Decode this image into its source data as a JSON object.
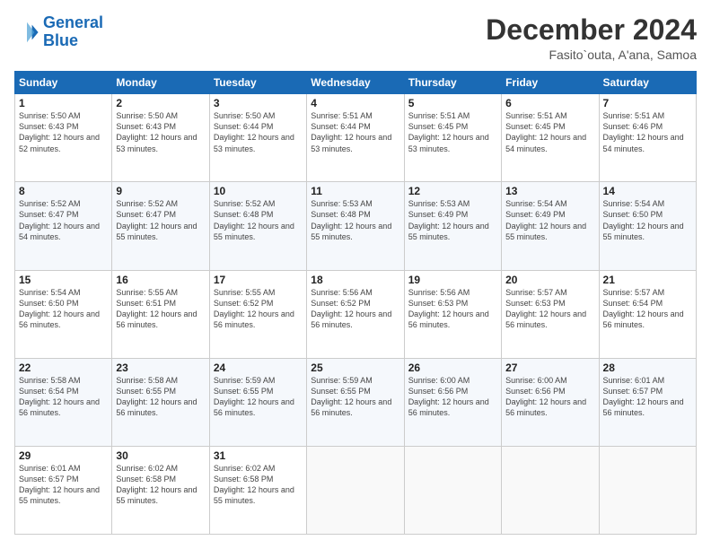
{
  "logo": {
    "line1": "General",
    "line2": "Blue"
  },
  "title": "December 2024",
  "location": "Fasito`outa, A'ana, Samoa",
  "days_header": [
    "Sunday",
    "Monday",
    "Tuesday",
    "Wednesday",
    "Thursday",
    "Friday",
    "Saturday"
  ],
  "weeks": [
    [
      {
        "num": "1",
        "sunrise": "5:50 AM",
        "sunset": "6:43 PM",
        "daylight": "12 hours and 52 minutes."
      },
      {
        "num": "2",
        "sunrise": "5:50 AM",
        "sunset": "6:43 PM",
        "daylight": "12 hours and 53 minutes."
      },
      {
        "num": "3",
        "sunrise": "5:50 AM",
        "sunset": "6:44 PM",
        "daylight": "12 hours and 53 minutes."
      },
      {
        "num": "4",
        "sunrise": "5:51 AM",
        "sunset": "6:44 PM",
        "daylight": "12 hours and 53 minutes."
      },
      {
        "num": "5",
        "sunrise": "5:51 AM",
        "sunset": "6:45 PM",
        "daylight": "12 hours and 53 minutes."
      },
      {
        "num": "6",
        "sunrise": "5:51 AM",
        "sunset": "6:45 PM",
        "daylight": "12 hours and 54 minutes."
      },
      {
        "num": "7",
        "sunrise": "5:51 AM",
        "sunset": "6:46 PM",
        "daylight": "12 hours and 54 minutes."
      }
    ],
    [
      {
        "num": "8",
        "sunrise": "5:52 AM",
        "sunset": "6:47 PM",
        "daylight": "12 hours and 54 minutes."
      },
      {
        "num": "9",
        "sunrise": "5:52 AM",
        "sunset": "6:47 PM",
        "daylight": "12 hours and 55 minutes."
      },
      {
        "num": "10",
        "sunrise": "5:52 AM",
        "sunset": "6:48 PM",
        "daylight": "12 hours and 55 minutes."
      },
      {
        "num": "11",
        "sunrise": "5:53 AM",
        "sunset": "6:48 PM",
        "daylight": "12 hours and 55 minutes."
      },
      {
        "num": "12",
        "sunrise": "5:53 AM",
        "sunset": "6:49 PM",
        "daylight": "12 hours and 55 minutes."
      },
      {
        "num": "13",
        "sunrise": "5:54 AM",
        "sunset": "6:49 PM",
        "daylight": "12 hours and 55 minutes."
      },
      {
        "num": "14",
        "sunrise": "5:54 AM",
        "sunset": "6:50 PM",
        "daylight": "12 hours and 55 minutes."
      }
    ],
    [
      {
        "num": "15",
        "sunrise": "5:54 AM",
        "sunset": "6:50 PM",
        "daylight": "12 hours and 56 minutes."
      },
      {
        "num": "16",
        "sunrise": "5:55 AM",
        "sunset": "6:51 PM",
        "daylight": "12 hours and 56 minutes."
      },
      {
        "num": "17",
        "sunrise": "5:55 AM",
        "sunset": "6:52 PM",
        "daylight": "12 hours and 56 minutes."
      },
      {
        "num": "18",
        "sunrise": "5:56 AM",
        "sunset": "6:52 PM",
        "daylight": "12 hours and 56 minutes."
      },
      {
        "num": "19",
        "sunrise": "5:56 AM",
        "sunset": "6:53 PM",
        "daylight": "12 hours and 56 minutes."
      },
      {
        "num": "20",
        "sunrise": "5:57 AM",
        "sunset": "6:53 PM",
        "daylight": "12 hours and 56 minutes."
      },
      {
        "num": "21",
        "sunrise": "5:57 AM",
        "sunset": "6:54 PM",
        "daylight": "12 hours and 56 minutes."
      }
    ],
    [
      {
        "num": "22",
        "sunrise": "5:58 AM",
        "sunset": "6:54 PM",
        "daylight": "12 hours and 56 minutes."
      },
      {
        "num": "23",
        "sunrise": "5:58 AM",
        "sunset": "6:55 PM",
        "daylight": "12 hours and 56 minutes."
      },
      {
        "num": "24",
        "sunrise": "5:59 AM",
        "sunset": "6:55 PM",
        "daylight": "12 hours and 56 minutes."
      },
      {
        "num": "25",
        "sunrise": "5:59 AM",
        "sunset": "6:55 PM",
        "daylight": "12 hours and 56 minutes."
      },
      {
        "num": "26",
        "sunrise": "6:00 AM",
        "sunset": "6:56 PM",
        "daylight": "12 hours and 56 minutes."
      },
      {
        "num": "27",
        "sunrise": "6:00 AM",
        "sunset": "6:56 PM",
        "daylight": "12 hours and 56 minutes."
      },
      {
        "num": "28",
        "sunrise": "6:01 AM",
        "sunset": "6:57 PM",
        "daylight": "12 hours and 56 minutes."
      }
    ],
    [
      {
        "num": "29",
        "sunrise": "6:01 AM",
        "sunset": "6:57 PM",
        "daylight": "12 hours and 55 minutes."
      },
      {
        "num": "30",
        "sunrise": "6:02 AM",
        "sunset": "6:58 PM",
        "daylight": "12 hours and 55 minutes."
      },
      {
        "num": "31",
        "sunrise": "6:02 AM",
        "sunset": "6:58 PM",
        "daylight": "12 hours and 55 minutes."
      },
      null,
      null,
      null,
      null
    ]
  ]
}
